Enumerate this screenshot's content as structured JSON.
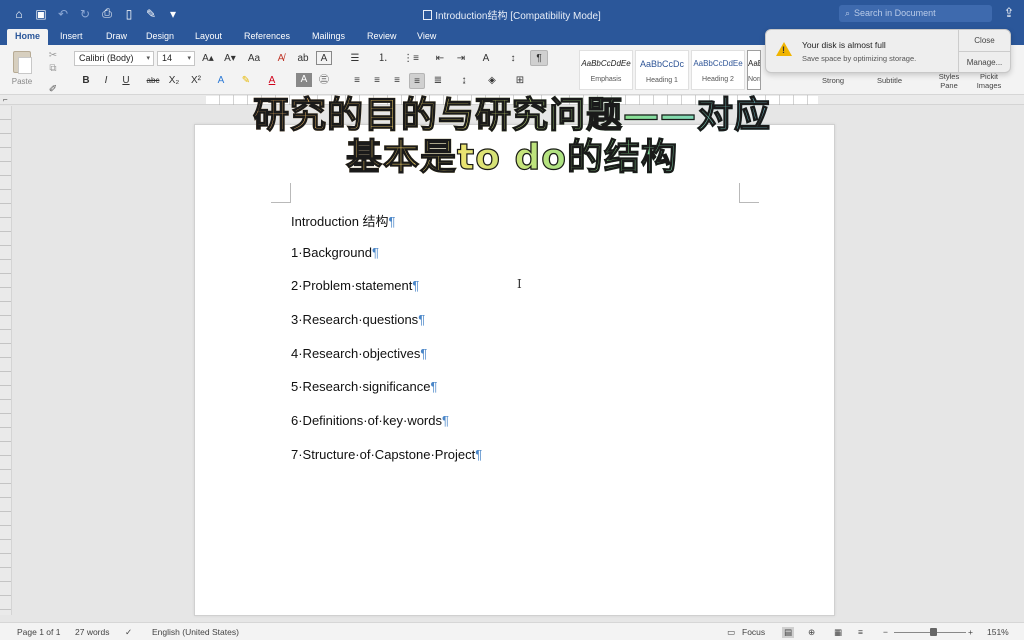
{
  "titlebar": {
    "document_title": "Introduction结构 [Compatibility Mode]",
    "search_placeholder": "Search in Document",
    "quick_access_icons": [
      "home-icon",
      "save-icon",
      "undo-icon",
      "redo-icon",
      "print-icon",
      "new-doc-icon",
      "edit-icon",
      "customize-icon"
    ]
  },
  "ribbon": {
    "tabs": [
      "Home",
      "Insert",
      "Draw",
      "Design",
      "Layout",
      "References",
      "Mailings",
      "Review",
      "View"
    ],
    "active_tab": "Home",
    "paste_label": "Paste",
    "font_name": "Calibri (Body)",
    "font_size": "14",
    "styles": [
      {
        "preview": "AaBbCcDdEe",
        "name": "Emphasis"
      },
      {
        "preview": "AaBbCcDc",
        "name": "Heading 1"
      },
      {
        "preview": "AaBbCcDdEe",
        "name": "Heading 2"
      },
      {
        "preview": "AaB",
        "name": "Normal"
      }
    ],
    "extra_styles": [
      "Strong",
      "Subtitle"
    ],
    "styles_pane_label": "Styles Pane",
    "pickit_label": "Pickit Images",
    "format_buttons": [
      "B",
      "I",
      "U",
      "abc",
      "X₂",
      "X²"
    ]
  },
  "notification": {
    "title": "Your disk is almost full",
    "body": "Save space by optimizing storage.",
    "close_label": "Close",
    "manage_label": "Manage..."
  },
  "overlay_caption": {
    "line1": "研究的目的与研究问题——对应",
    "line2": "基本是to do的结构"
  },
  "document": {
    "lines": [
      "Introduction 结构",
      "1·Background",
      "2·Problem·statement",
      "3·Research·questions",
      "4·Research·objectives",
      "5·Research·significance",
      "6·Definitions·of·key·words",
      "7·Structure·of·Capstone·Project"
    ],
    "pilcrow": "¶"
  },
  "statusbar": {
    "page": "Page 1 of 1",
    "words": "27 words",
    "language": "English (United States)",
    "focus_label": "Focus",
    "zoom": "151%"
  },
  "colors": {
    "accent": "#2b579a",
    "pilcrow": "#4a86c8",
    "warning": "#f0b400"
  }
}
